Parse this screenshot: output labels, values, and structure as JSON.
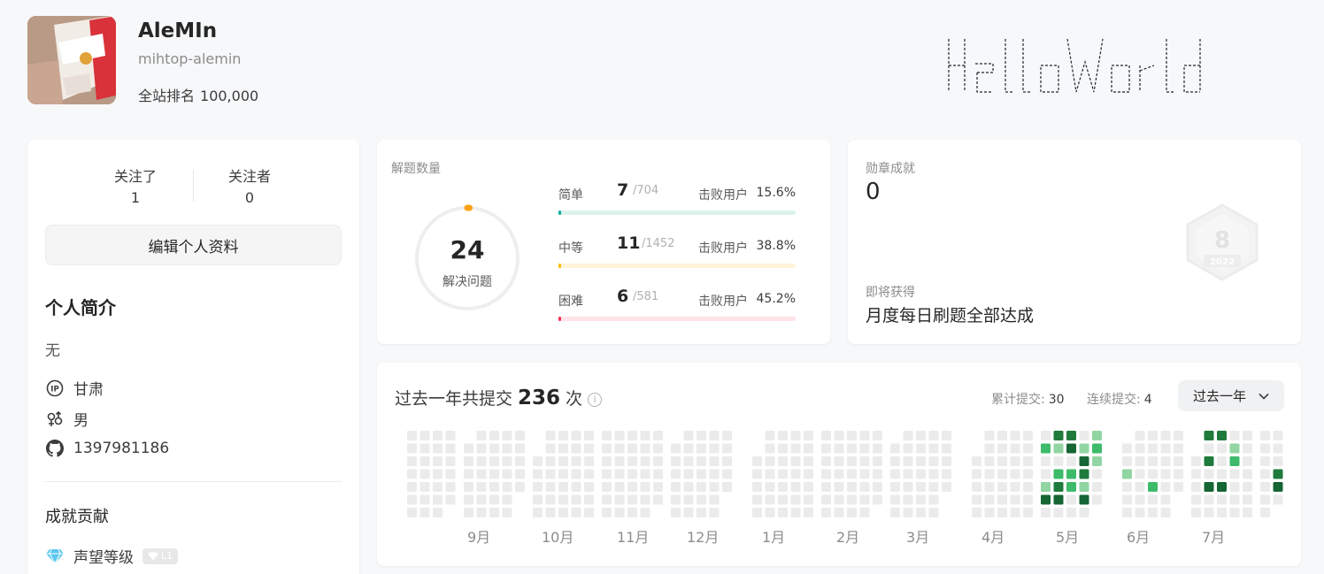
{
  "profile": {
    "name": "AleMIn",
    "username": "mihtop-alemin",
    "rank_label": "全站排名",
    "rank_value": "100,000"
  },
  "ascii_banner": "HelloWorld",
  "follow": {
    "following_label": "关注了",
    "following_count": "1",
    "followers_label": "关注者",
    "followers_count": "0"
  },
  "edit_button": "编辑个人资料",
  "about": {
    "title": "个人简介",
    "bio": "无",
    "location_icon": "ip-icon",
    "location": "甘肃",
    "gender_icon": "gender-icon",
    "gender": "男",
    "github_icon": "github-icon",
    "github": "1397981186"
  },
  "achievements": {
    "title": "成就贡献",
    "reputation_icon": "diamond-icon",
    "reputation_label": "声望等级",
    "reputation_level": "L1"
  },
  "solved": {
    "label": "解题数量",
    "total": "24",
    "total_label": "解决问题",
    "total_fraction": 0.007,
    "difficulties": [
      {
        "name": "简单",
        "count": "7",
        "total": "/704",
        "beat_label": "击败用户",
        "beat": "15.6%",
        "fraction": 0.01,
        "color": "#00af9b",
        "track": "#dbf3ec"
      },
      {
        "name": "中等",
        "count": "11",
        "total": "/1452",
        "beat_label": "击败用户",
        "beat": "38.8%",
        "fraction": 0.008,
        "color": "#ffb800",
        "track": "#fff3d9"
      },
      {
        "name": "困难",
        "count": "6",
        "total": "/581",
        "beat_label": "击败用户",
        "beat": "45.2%",
        "fraction": 0.01,
        "color": "#ff2d55",
        "track": "#ffe3e7"
      }
    ]
  },
  "badges": {
    "label": "勋章成就",
    "count": "0",
    "upcoming_label": "即将获得",
    "upcoming": "月度每日刷题全部达成",
    "badge_digit": "8",
    "badge_year": "2022"
  },
  "calendar": {
    "title_prefix": "过去一年共提交",
    "submissions": "236",
    "title_suffix": "次",
    "info_icon": "info-icon",
    "total_days_label": "累计提交:",
    "total_days": "30",
    "streak_label": "连续提交:",
    "streak": "4",
    "range": "过去一年",
    "months": [
      "9月",
      "10月",
      "11月",
      "12月",
      "1月",
      "2月",
      "3月",
      "4月",
      "5月",
      "6月",
      "7月"
    ],
    "colors": {
      "empty": "#ebebeb",
      "l1": "#91d5a3",
      "l2": "#3dbb6a",
      "l3": "#1e7b3c",
      "l4": "#166534"
    }
  }
}
